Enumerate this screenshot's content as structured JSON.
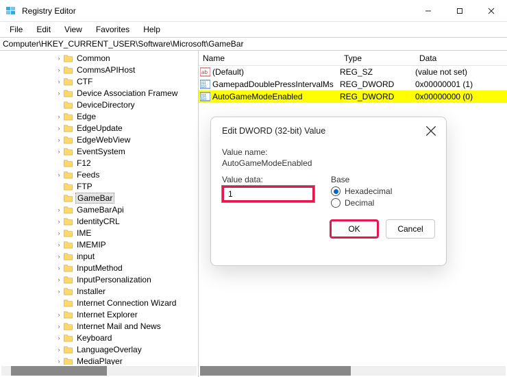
{
  "window": {
    "title": "Registry Editor"
  },
  "menu": {
    "file": "File",
    "edit": "Edit",
    "view": "View",
    "favorites": "Favorites",
    "help": "Help"
  },
  "address": "Computer\\HKEY_CURRENT_USER\\Software\\Microsoft\\GameBar",
  "tree": {
    "items": [
      {
        "label": "Common",
        "depth": 0,
        "exp": true
      },
      {
        "label": "CommsAPIHost",
        "depth": 0,
        "exp": true
      },
      {
        "label": "CTF",
        "depth": 0,
        "exp": true
      },
      {
        "label": "Device Association Framew",
        "depth": 0,
        "exp": true
      },
      {
        "label": "DeviceDirectory",
        "depth": 0,
        "exp": false
      },
      {
        "label": "Edge",
        "depth": 0,
        "exp": true
      },
      {
        "label": "EdgeUpdate",
        "depth": 0,
        "exp": true
      },
      {
        "label": "EdgeWebView",
        "depth": 0,
        "exp": true
      },
      {
        "label": "EventSystem",
        "depth": 0,
        "exp": true
      },
      {
        "label": "F12",
        "depth": 0,
        "exp": false
      },
      {
        "label": "Feeds",
        "depth": 0,
        "exp": true
      },
      {
        "label": "FTP",
        "depth": 0,
        "exp": false
      },
      {
        "label": "GameBar",
        "depth": 0,
        "exp": false,
        "selected": true
      },
      {
        "label": "GameBarApi",
        "depth": 0,
        "exp": true
      },
      {
        "label": "IdentityCRL",
        "depth": 0,
        "exp": true
      },
      {
        "label": "IME",
        "depth": 0,
        "exp": true
      },
      {
        "label": "IMEMIP",
        "depth": 0,
        "exp": true
      },
      {
        "label": "input",
        "depth": 0,
        "exp": true
      },
      {
        "label": "InputMethod",
        "depth": 0,
        "exp": true
      },
      {
        "label": "InputPersonalization",
        "depth": 0,
        "exp": true
      },
      {
        "label": "Installer",
        "depth": 0,
        "exp": true
      },
      {
        "label": "Internet Connection Wizard",
        "depth": 0,
        "exp": false
      },
      {
        "label": "Internet Explorer",
        "depth": 0,
        "exp": true
      },
      {
        "label": "Internet Mail and News",
        "depth": 0,
        "exp": true
      },
      {
        "label": "Keyboard",
        "depth": 0,
        "exp": true
      },
      {
        "label": "LanguageOverlay",
        "depth": 0,
        "exp": true
      },
      {
        "label": "MediaPlayer",
        "depth": 0,
        "exp": true
      }
    ]
  },
  "list": {
    "head": {
      "name": "Name",
      "type": "Type",
      "data": "Data"
    },
    "rows": [
      {
        "icon": "string",
        "name": "(Default)",
        "type": "REG_SZ",
        "data": "(value not set)",
        "hl": false
      },
      {
        "icon": "dword",
        "name": "GamepadDoublePressIntervalMs",
        "type": "REG_DWORD",
        "data": "0x00000001 (1)",
        "hl": false
      },
      {
        "icon": "dword",
        "name": "AutoGameModeEnabled",
        "type": "REG_DWORD",
        "data": "0x00000000 (0)",
        "hl": true
      }
    ]
  },
  "dialog": {
    "title": "Edit DWORD (32-bit) Value",
    "value_name_label": "Value name:",
    "value_name": "AutoGameModeEnabled",
    "value_data_label": "Value data:",
    "value_data": "1",
    "base_label": "Base",
    "hex_label": "Hexadecimal",
    "dec_label": "Decimal",
    "ok": "OK",
    "cancel": "Cancel"
  }
}
